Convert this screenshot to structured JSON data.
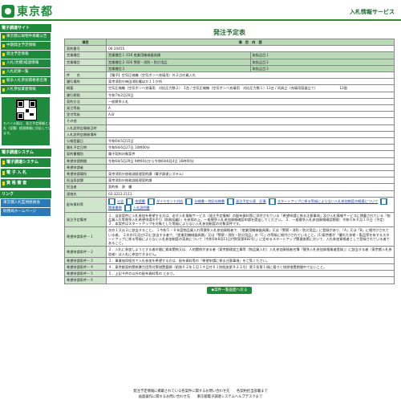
{
  "header": {
    "logo_text": "東京都",
    "site_title": "入札情報サービス"
  },
  "sidebar": {
    "section_head": "電子調達サイト",
    "items": [
      "東京都公報物件掲載公告",
      "中期発注予定情報",
      "発注予定情報",
      "入札(見積)経過情報",
      "入札結果一覧",
      "競争入札参加資格者名簿",
      "入札参加業者情報"
    ],
    "qr_text": "モバイル版は、発注予定情報と入札（見積）経過情報に対応しています。",
    "systems_head": "電子調達システム",
    "big_items": [
      "電子調達システム(TOP)",
      "電 子 入 札",
      "資 格 審 査"
    ],
    "links_head": "リンク",
    "link_items": [
      "東京都入札監視委員会",
      "財務局ホームページ"
    ]
  },
  "main": {
    "heading": "発注予定表",
    "col_item": "項目",
    "col_content": "項　目　内　容",
    "rows": [
      {
        "label": "契約番号",
        "value": "06-20455"
      },
      {
        "label": "営業種目",
        "value": "営業種目１ 016 産業用機械器具類",
        "extra": "取扱品目１"
      },
      {
        "label": "営業種目",
        "value": "営業種目２ 026 警察・消防・防災用品",
        "extra": "取扱品目２"
      },
      {
        "label": "",
        "value": "営業種目３",
        "extra": "取扱品目３"
      },
      {
        "label": "件　　名",
        "value": "【電子】空気圧縮機（空気ボンベ充填用）外２点の買入れ"
      },
      {
        "label": "履行場所",
        "value": "東京消防庁神田消防署ほか１１か所"
      },
      {
        "label": "概要",
        "value": "空気圧縮機（空気ボンベ充填用　対応圧力数２）　1台 / 空気圧縮機（空気ボンベ充填用　対応圧力数１）11台 / 同具立（充填用容器立て）　　　　　　　12個"
      },
      {
        "label": "履行期限",
        "value": "令和7年2月20日"
      },
      {
        "label": "契約方法",
        "value": "一般競争入札"
      },
      {
        "label": "発注等級",
        "value": "A"
      },
      {
        "label": "受付等級",
        "value": "A,B"
      },
      {
        "label": "その他",
        "value": ""
      },
      {
        "label": "入札説明会開催日時",
        "value": ""
      },
      {
        "label": "入札説明会開催場所",
        "value": ""
      },
      {
        "label": "公報登載日",
        "value": "令和6年5月15日"
      },
      {
        "label": "開札予定日時",
        "value": "令和6年6月27日 10時00分"
      },
      {
        "label": "契約書種別",
        "value": "電子契約対象案件"
      },
      {
        "label": "希望申請期間",
        "value": "令和6年5月29日 9時00分から令和6年6月4日 16時00分"
      },
      {
        "label": "希望申請者",
        "value": ""
      },
      {
        "label": "希望申請場所",
        "value": "東京消防庁総務部経理契約課（電子調達システム）"
      },
      {
        "label": "担当局部課",
        "value": "東京消防庁総務部経理契約課"
      },
      {
        "label": "担当者",
        "value": "契約係　源　優"
      },
      {
        "label": "連絡先",
        "value": "03-3212-2111"
      }
    ],
    "docs_label": "配布資料等",
    "doc_links": [
      "公告",
      "申請書",
      "ダイヤモンド対応",
      "仕様書・特記仕様書",
      "発注予定公表　記事",
      "スタートアップに係る等級によらない入札参加制度の概要について",
      "関連書類",
      "入札説明書"
    ],
    "notes_label": "発注予定備考",
    "notes_value": "１．当該案件に入札参加を希望する方は、必ず入札情報サービス（発注予定情報）の配布資料等に添付されている「希望申請に係る注意事項」及び入札情報サービスに掲載されている「物品買入れ等競争入札希望申請の手引（財務局編）」を参照の上、一般競争入札参加資格確認申請を提出してください。 ２．一般競争入札参加資格確認期限：令和６年６月１９日（予定） ３．本案件はスタートアップを対象とした等級によらない入札参加制度の対象案件です。",
    "cond_rows": [
      {
        "label": "希望申請条件－１",
        "value": "次の１又は２に該当すること。 １今和５・６年度物品買入れ等競争入札参加資格者で、「産業用機械器具類」又は「警察・消防・防災用品」に登録があり、「A」又は「B」に格付けされている者。 ２次の(1)及び(2)に該当する者で、「産業用機械器具類」又は「警察・消防・防災用品」の「C」の等級に格付けされていること。(1)東京都が「優れた技術・製品等を有するスタートアップに係る等級によらない入札参加制度の実施について（令和5年8月11日付財契第682号）」に定めるスタートアップ関連施策において、入札参加資格者として登録されている者であること。"
      },
      {
        "label": "希望申請条件－２",
        "value": "２．入札に参加しようとする者の間に資本関係又は、人的関係がある者（東京都建設工事等（物品買入れ）入札参加資格者名簿「競争入札参加資格業者登録」）に該当する者（東京都入札参加者）は入札に参加できません。"
      },
      {
        "label": "希望申請条件－３",
        "value": "３．事業協同組合で入札参加を希望する方は、配布資料等の「希望申請に係る注意事項」をご覧ください。"
      },
      {
        "label": "希望申請条件－４",
        "value": "４．東京都契約関係暴力団等対策措置要綱（昭和６２年１月１４日付６１財経庶第９２２号）第５条第１項に基づく排除措置期間中でないこと。"
      },
      {
        "label": "希望申請条件－５",
        "value": "５．上記４件の以外の配布資料等の とおり。"
      },
      {
        "label": "希望申請条件－６",
        "value": ""
      }
    ],
    "return_button": "◆案件一覧画面へ戻る"
  },
  "footer": {
    "line1": "発注予定情報に掲載されている各案件に関するお問い合わせ先　　各契約担当部署まで",
    "line2": "画面操作に関するお問い合わせ先　　東京都電子調達システムヘルプデスクまで"
  }
}
